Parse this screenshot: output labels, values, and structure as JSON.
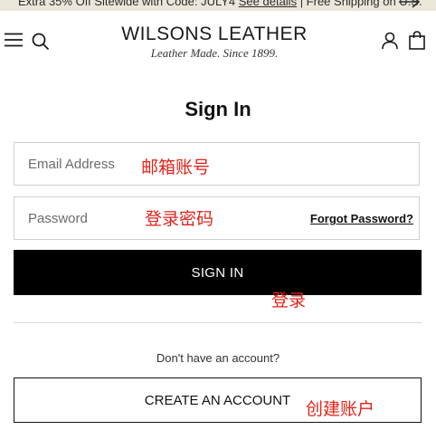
{
  "promo": {
    "text": "Extra 35% Off Sitewide with Code: JULY4 ",
    "link": "See details",
    "suffix": " | Free Shipping on U.S.",
    "arrow_icon": "arrow-right-icon"
  },
  "header": {
    "menu_icon": "hamburger-menu-icon",
    "search_icon": "search-icon",
    "logo_name": "WILSONS LEATHER",
    "logo_tagline": "Leather Made. Since 1899.",
    "account_icon": "user-icon",
    "bag_icon": "shopping-bag-icon"
  },
  "signin": {
    "title": "Sign In",
    "email_placeholder": "Email Address",
    "password_placeholder": "Password",
    "forgot_password": "Forgot Password?",
    "signin_button": "SIGN IN",
    "no_account_text": "Don't have an account?",
    "create_account_button": "CREATE AN ACCOUNT"
  },
  "annotations": {
    "email": "邮箱账号",
    "password": "登录密码",
    "signin": "登录",
    "create_account": "创建账户",
    "color": "#e2231a"
  },
  "colors": {
    "promo_bg": "#ebe6da",
    "primary_button": "#000000",
    "border": "#cfcfcf"
  }
}
